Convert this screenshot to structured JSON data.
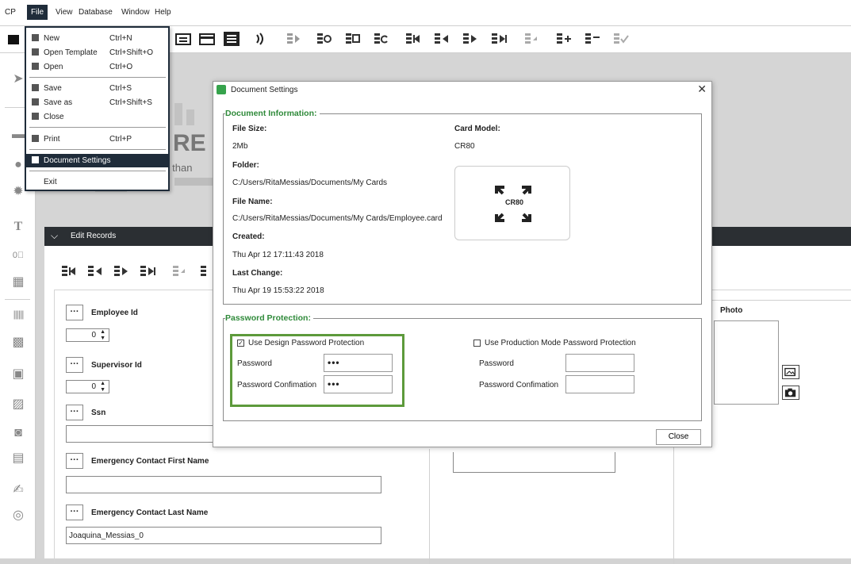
{
  "menubar": {
    "items": [
      "CP",
      "File",
      "View",
      "Database",
      "Window",
      "Help"
    ]
  },
  "file_menu": {
    "items": [
      {
        "label": "New",
        "shortcut": "Ctrl+N"
      },
      {
        "label": "Open Template",
        "shortcut": "Ctrl+Shift+O"
      },
      {
        "label": "Open",
        "shortcut": "Ctrl+O"
      },
      {
        "label": "Save",
        "shortcut": "Ctrl+S"
      },
      {
        "label": "Save as",
        "shortcut": "Ctrl+Shift+S"
      },
      {
        "label": "Close",
        "shortcut": ""
      },
      {
        "label": "Print",
        "shortcut": "Ctrl+P"
      },
      {
        "label": "Document Settings",
        "shortcut": ""
      },
      {
        "label": "Exit",
        "shortcut": ""
      }
    ]
  },
  "background": {
    "logo_text": "RE",
    "logo_subtext": "re than"
  },
  "edit_records": {
    "title": "Edit Records",
    "fields": {
      "employee_id": {
        "label": "Employee Id",
        "value": "0"
      },
      "supervisor_id": {
        "label": "Supervisor Id",
        "value": "0"
      },
      "ssn": {
        "label": "Ssn",
        "value": ""
      },
      "emergency_first": {
        "label": "Emergency Contact First Name",
        "value": ""
      },
      "emergency_last": {
        "label": "Emergency Contact Last Name",
        "value": "Joaquina_Messias_0"
      }
    },
    "photo_label": "Photo"
  },
  "dialog": {
    "title": "Document Settings",
    "doc_info": {
      "section_title": "Document Information:",
      "file_size_label": "File Size:",
      "file_size": "2Mb",
      "folder_label": "Folder:",
      "folder": "C:/Users/RitaMessias/Documents/My Cards",
      "file_name_label": "File Name:",
      "file_name": "C:/Users/RitaMessias/Documents/My Cards/Employee.card",
      "created_label": "Created:",
      "created": "Thu Apr 12 17:11:43 2018",
      "last_change_label": "Last Change:",
      "last_change": "Thu Apr 19 15:53:22 2018",
      "card_model_label": "Card Model:",
      "card_model": "CR80",
      "card_icon_text": "CR80"
    },
    "password": {
      "section_title": "Password Protection:",
      "design_checkbox": "Use Design Password Protection",
      "design_checked": true,
      "production_checkbox": "Use Production Mode Password Protection",
      "production_checked": false,
      "password_label": "Password",
      "confirm_label": "Password Confimation",
      "design_password": "•••",
      "design_confirm": "•••",
      "prod_password": "",
      "prod_confirm": ""
    },
    "close_button": "Close"
  },
  "colors": {
    "accent_green": "#2f8a3a",
    "highlight_green": "#5d9a3b",
    "menu_dark": "#1f2c3a"
  }
}
